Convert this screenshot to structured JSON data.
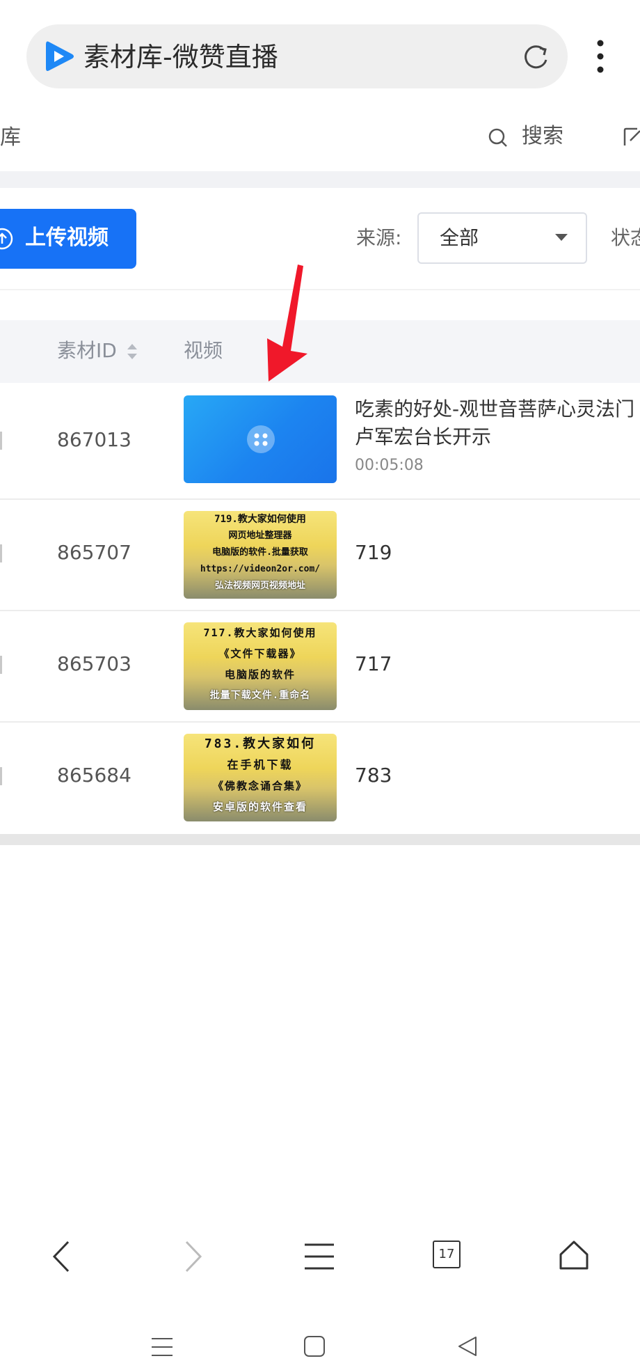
{
  "address_bar": {
    "title": "素材库-微赞直播"
  },
  "sub_header": {
    "left_text": "库",
    "search_label": "搜索"
  },
  "toolbar": {
    "upload_label": "上传视频",
    "source_label": "来源:",
    "source_value": "全部",
    "status_label": "状态"
  },
  "table": {
    "headers": {
      "id": "素材ID",
      "video": "视频"
    },
    "rows": [
      {
        "id": "867013",
        "title_line1": "吃素的好处-观世音菩萨心灵法门",
        "title_line2": "卢军宏台长开示",
        "duration": "00:05:08",
        "thumb": "blue"
      },
      {
        "id": "865707",
        "title": "719",
        "thumb_lines": [
          "719.教大家如何使用",
          "网页地址整理器",
          "电脑版的软件.批量获取",
          "https://videon2or.com/",
          "弘法视频网页视频地址"
        ]
      },
      {
        "id": "865703",
        "title": "717",
        "thumb_lines": [
          "717.教大家如何使用",
          "《文件下载器》",
          "电脑版的软件",
          "批量下载文件.重命名"
        ]
      },
      {
        "id": "865684",
        "title": "783",
        "thumb_lines": [
          "783.教大家如何",
          "在手机下载",
          "《佛教念诵合集》",
          "安卓版的软件查看"
        ]
      }
    ]
  },
  "browser_nav": {
    "tab_count": "17"
  },
  "colors": {
    "accent": "#1772f6",
    "arrow": "#f0182a"
  }
}
